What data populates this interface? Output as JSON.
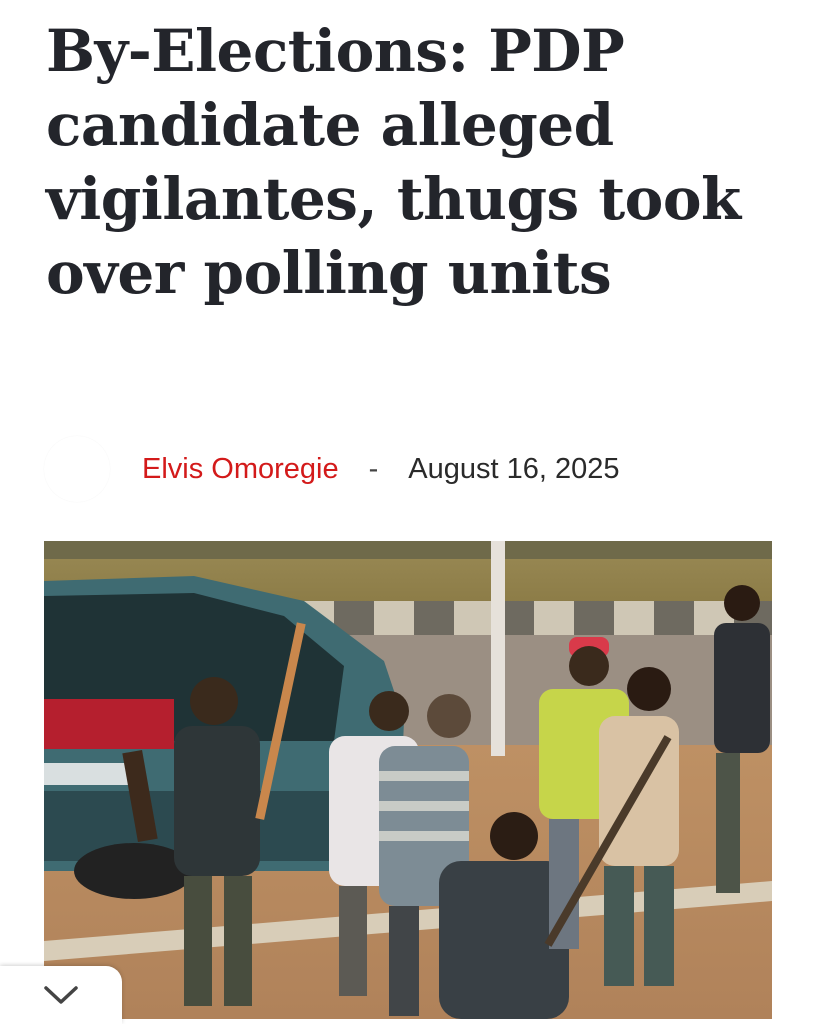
{
  "article": {
    "title": "By-Elections: PDP candidate alleged vigilantes, thugs took over polling units",
    "author": "Elvis Omoregie",
    "separator": "-",
    "date": "August 16, 2025"
  },
  "image": {
    "description_icon": "news-photo"
  },
  "controls": {
    "collapse_icon": "chevron-down-icon"
  },
  "colors": {
    "headline": "#23252b",
    "author": "#d31a1a",
    "date": "#2a2a2a"
  }
}
